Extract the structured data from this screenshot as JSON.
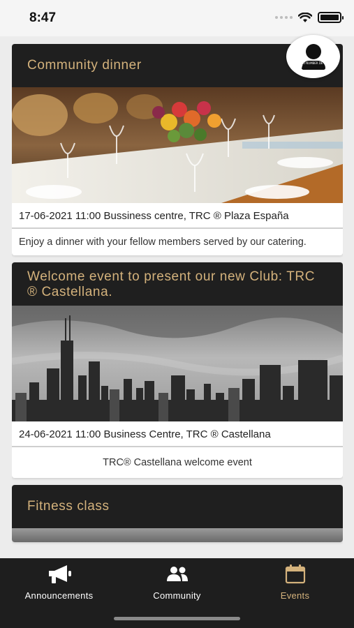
{
  "status_bar": {
    "time": "8:47"
  },
  "events": [
    {
      "title": "Community dinner",
      "image": "dinner-table-photo",
      "meta": "17-06-2021 11:00   Bussiness centre, TRC ® Plaza España",
      "description": "Enjoy a dinner with your fellow members served by our catering."
    },
    {
      "title": "Welcome event to present our new Club: TRC ® Castellana.",
      "image": "city-skyline-photo",
      "meta": "24-06-2021 11:00   Business Centre, TRC ® Castellana",
      "description": "TRC® Castellana welcome event"
    },
    {
      "title": "Fitness class"
    }
  ],
  "avatar": {
    "tag": "TU NUMBER DE T"
  },
  "tab_bar": {
    "items": [
      {
        "label": "Announcements",
        "icon": "megaphone-icon"
      },
      {
        "label": "Community",
        "icon": "people-icon"
      },
      {
        "label": "Events",
        "icon": "calendar-icon",
        "active": true
      }
    ]
  },
  "colors": {
    "accent": "#d4b27c",
    "header_bg": "#1f1f1f",
    "tab_bg": "#1e1e1e"
  }
}
